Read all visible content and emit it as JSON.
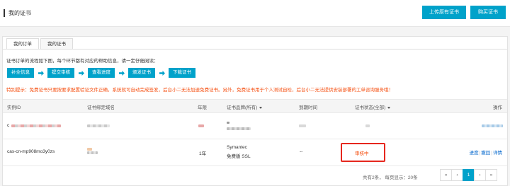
{
  "header": {
    "title": "我的证书",
    "upload_btn": "上传原有证书",
    "buy_btn": "购买证书"
  },
  "tabs": [
    {
      "label": "我的订单",
      "active": true
    },
    {
      "label": "我的证书",
      "active": false
    }
  ],
  "intro": "证书订单的流程如下图，每个环节都有对应的帮助信息，请一定仔细阅读：",
  "steps": [
    "补全信息",
    "提交审核",
    "查看进度",
    "颁发证书",
    "下载证书"
  ],
  "notice": "特别提示：免费证书只要按要求配置验证文件正确，系统就可自动完成签发，后台小二无法加速免费证书。另外，免费证书用于个人测试自检，后台小二无法提供安装部署的工单咨询服务哦！",
  "table": {
    "headers": {
      "id": "实例ID",
      "domain": "证书绑定域名",
      "years": "年限",
      "brand": "证书品牌(所有)",
      "expire": "到期时间",
      "status": "证书状态(全部)",
      "ops": "操作"
    },
    "rows": [
      {
        "id_prefix": "c",
        "years": "",
        "brand_line1": "",
        "brand_line2": "",
        "expire": "",
        "status": "",
        "ops": []
      },
      {
        "id": "cas-cn-mp908mo3y0zs",
        "years": "1年",
        "brand_line1": "Symantec",
        "brand_line2": "免费版 SSL",
        "expire": "--",
        "status": "审核中",
        "ops": [
          "进度",
          "撤回",
          "详情"
        ]
      }
    ]
  },
  "pagination": {
    "info": "共有2条， 每页显示：20条",
    "first": "«",
    "prev": "‹",
    "current": "1",
    "next": "›",
    "last": "»"
  },
  "colors": {
    "primary": "#00a2ca",
    "warning": "#f54e0f",
    "highlight_border": "#e6271e",
    "link": "#0066cc"
  }
}
